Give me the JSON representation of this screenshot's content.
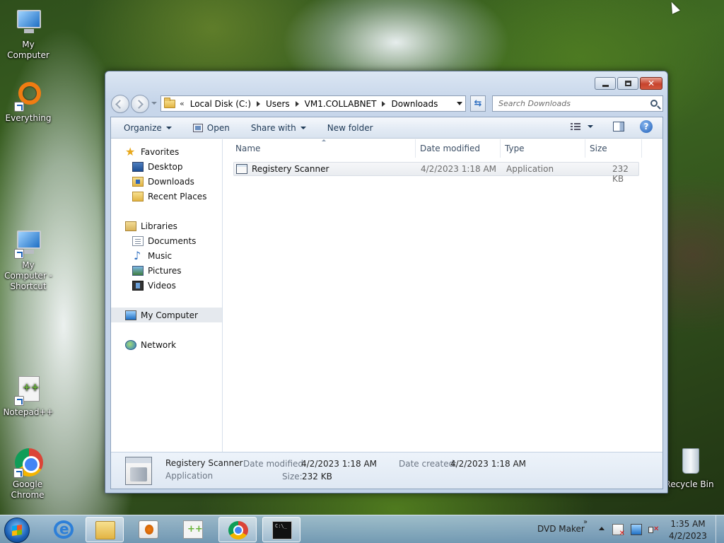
{
  "desktop": {
    "icons": [
      {
        "label": "My Computer",
        "icon": "computer-icon"
      },
      {
        "label": "Everything",
        "icon": "everything-icon"
      },
      {
        "label": "My Computer - Shortcut",
        "icon": "computer-shortcut-icon"
      },
      {
        "label": "Notepad++",
        "icon": "notepadpp-icon"
      },
      {
        "label": "Google Chrome",
        "icon": "chrome-icon"
      },
      {
        "label": "Recycle Bin",
        "icon": "recycle-bin-icon"
      }
    ]
  },
  "window": {
    "breadcrumb_overflow": "«",
    "breadcrumb": [
      "Local Disk (C:)",
      "Users",
      "VM1.COLLABNET",
      "Downloads"
    ],
    "search_placeholder": "Search Downloads",
    "toolbar": {
      "organize": "Organize",
      "open": "Open",
      "share_with": "Share with",
      "new_folder": "New folder"
    },
    "nav": {
      "favorites_header": "Favorites",
      "favorites": [
        "Desktop",
        "Downloads",
        "Recent Places"
      ],
      "libraries_header": "Libraries",
      "libraries": [
        "Documents",
        "Music",
        "Pictures",
        "Videos"
      ],
      "my_computer": "My Computer",
      "network": "Network"
    },
    "columns": {
      "name": "Name",
      "date_modified": "Date modified",
      "type": "Type",
      "size": "Size"
    },
    "files": [
      {
        "name": "Registery Scanner",
        "date_modified": "4/2/2023 1:18 AM",
        "type": "Application",
        "size": "232 KB"
      }
    ],
    "details": {
      "name": "Registery Scanner",
      "type": "Application",
      "date_modified_label": "Date modified:",
      "date_modified": "4/2/2023 1:18 AM",
      "size_label": "Size:",
      "size": "232 KB",
      "date_created_label": "Date created:",
      "date_created": "4/2/2023 1:18 AM"
    }
  },
  "taskbar": {
    "toolbar_label": "DVD Maker",
    "toolbar_overflow": "»",
    "time": "1:35 AM",
    "date": "4/2/2023"
  }
}
